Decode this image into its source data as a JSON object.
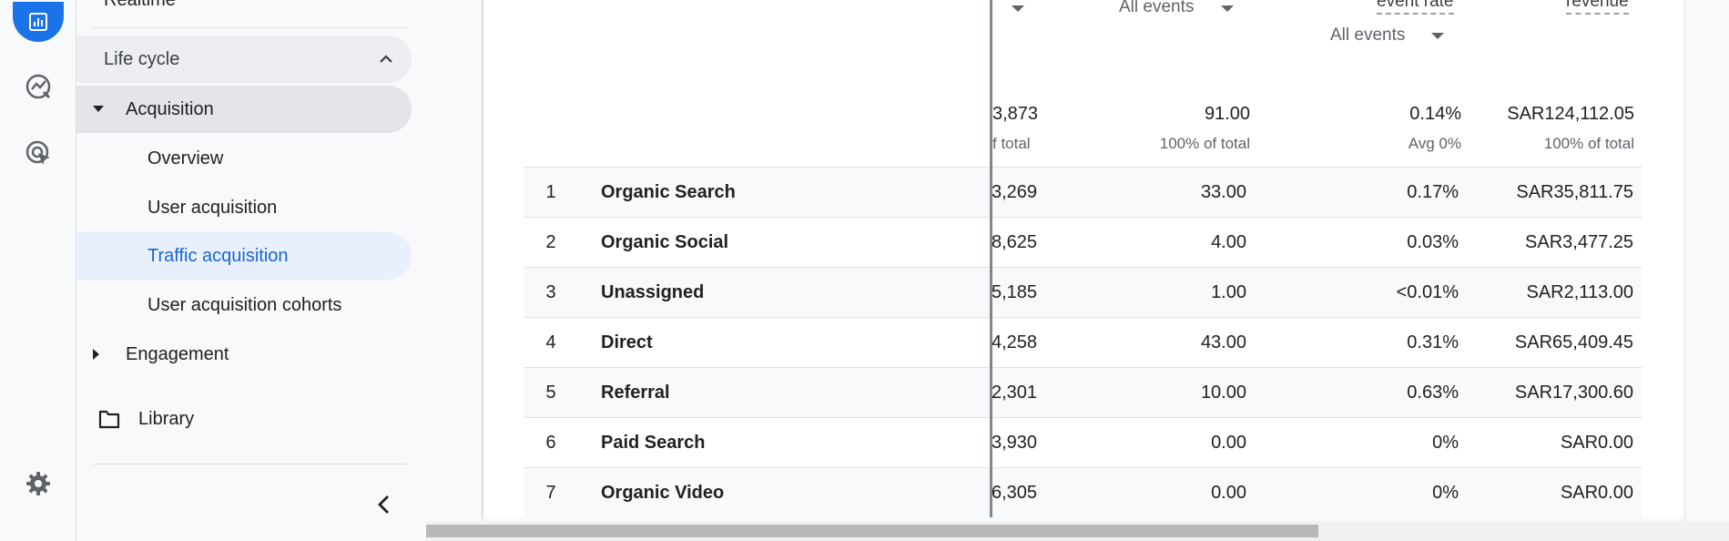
{
  "nav": {
    "realtime_label": "Realtime",
    "lifecycle_label": "Life cycle",
    "acquisition_label": "Acquisition",
    "overview_label": "Overview",
    "user_acquisition_label": "User acquisition",
    "traffic_acquisition_label": "Traffic acquisition",
    "user_acquisition_cohorts_label": "User acquisition cohorts",
    "engagement_label": "Engagement",
    "library_label": "Library"
  },
  "header": {
    "events_dropdown_1": "All events",
    "events_dropdown_2": "All events",
    "event_rate_label": "event rate",
    "revenue_label": "revenue"
  },
  "totals": {
    "c1": "3,873",
    "c1_sub": "f total",
    "c2": "91.00",
    "c2_sub": "100% of total",
    "c3": "0.14%",
    "c3_sub": "Avg 0%",
    "c4": "SAR124,112.05",
    "c4_sub": "100% of total"
  },
  "rows": [
    {
      "idx": "1",
      "name": "Organic Search",
      "c1": "3,269",
      "c2": "33.00",
      "c3": "0.17%",
      "c4": "SAR35,811.75"
    },
    {
      "idx": "2",
      "name": "Organic Social",
      "c1": "8,625",
      "c2": "4.00",
      "c3": "0.03%",
      "c4": "SAR3,477.25"
    },
    {
      "idx": "3",
      "name": "Unassigned",
      "c1": "5,185",
      "c2": "1.00",
      "c3": "<0.01%",
      "c4": "SAR2,113.00"
    },
    {
      "idx": "4",
      "name": "Direct",
      "c1": "4,258",
      "c2": "43.00",
      "c3": "0.31%",
      "c4": "SAR65,409.45"
    },
    {
      "idx": "5",
      "name": "Referral",
      "c1": "2,301",
      "c2": "10.00",
      "c3": "0.63%",
      "c4": "SAR17,300.60"
    },
    {
      "idx": "6",
      "name": "Paid Search",
      "c1": "3,930",
      "c2": "0.00",
      "c3": "0%",
      "c4": "SAR0.00"
    },
    {
      "idx": "7",
      "name": "Organic Video",
      "c1": "6,305",
      "c2": "0.00",
      "c3": "0%",
      "c4": "SAR0.00"
    }
  ],
  "icons": {
    "reports": "bar-chart-icon",
    "explore": "explore-icon",
    "advertising": "advertising-icon",
    "settings": "gear-icon",
    "collapse": "chevron-left-icon",
    "library": "folder-icon"
  },
  "colors": {
    "accent": "#1a73e8",
    "selected_bg": "#e8f0fe",
    "selected_text": "#1967d2"
  }
}
